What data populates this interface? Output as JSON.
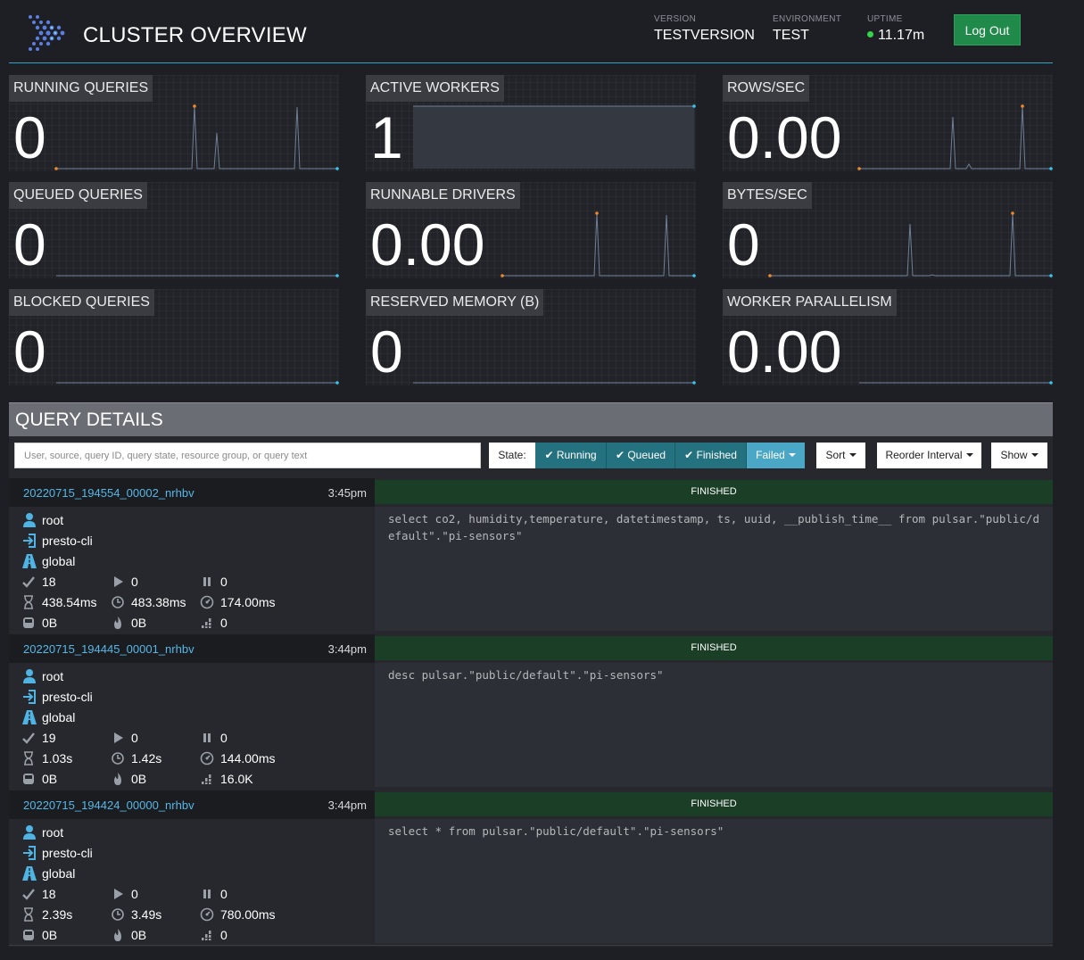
{
  "header": {
    "title": "CLUSTER OVERVIEW",
    "version_label": "VERSION",
    "version": "TESTVERSION",
    "environment_label": "ENVIRONMENT",
    "environment": "TEST",
    "uptime_label": "UPTIME",
    "uptime": "11.17m",
    "logout_label": "Log Out"
  },
  "metrics": {
    "running_queries": {
      "label": "RUNNING QUERIES",
      "value": "0"
    },
    "active_workers": {
      "label": "ACTIVE WORKERS",
      "value": "1"
    },
    "rows_sec": {
      "label": "ROWS/SEC",
      "value": "0.00"
    },
    "queued_queries": {
      "label": "QUEUED QUERIES",
      "value": "0"
    },
    "runnable_drivers": {
      "label": "RUNNABLE DRIVERS",
      "value": "0.00"
    },
    "bytes_sec": {
      "label": "BYTES/SEC",
      "value": "0"
    },
    "blocked_queries": {
      "label": "BLOCKED QUERIES",
      "value": "0"
    },
    "reserved_memory": {
      "label": "RESERVED MEMORY (B)",
      "value": "0"
    },
    "worker_parallelism": {
      "label": "WORKER PARALLELISM",
      "value": "0.00"
    }
  },
  "query_details": {
    "title": "QUERY DETAILS",
    "search_placeholder": "User, source, query ID, query state, resource group, or query text",
    "state_label": "State:",
    "filters": {
      "running": "Running",
      "queued": "Queued",
      "finished": "Finished",
      "failed": "Failed"
    },
    "sort_label": "Sort",
    "reorder_label": "Reorder Interval",
    "show_label": "Show"
  },
  "queries": [
    {
      "id": "20220715_194554_00002_nrhbv",
      "time": "3:45pm",
      "state": "FINISHED",
      "user": "root",
      "source": "presto-cli",
      "resource_group": "global",
      "completed_splits": "18",
      "running_splits": "0",
      "queued_splits": "0",
      "wall_time": "438.54ms",
      "elapsed_time": "483.38ms",
      "cpu_time": "174.00ms",
      "memory": "0B",
      "peak_memory": "0B",
      "input_rows": "0",
      "sql": "select co2, humidity,temperature, datetimestamp, ts, uuid, __publish_time__ from pulsar.\"public/default\".\"pi-sensors\""
    },
    {
      "id": "20220715_194445_00001_nrhbv",
      "time": "3:44pm",
      "state": "FINISHED",
      "user": "root",
      "source": "presto-cli",
      "resource_group": "global",
      "completed_splits": "19",
      "running_splits": "0",
      "queued_splits": "0",
      "wall_time": "1.03s",
      "elapsed_time": "1.42s",
      "cpu_time": "144.00ms",
      "memory": "0B",
      "peak_memory": "0B",
      "input_rows": "16.0K",
      "sql": "desc pulsar.\"public/default\".\"pi-sensors\""
    },
    {
      "id": "20220715_194424_00000_nrhbv",
      "time": "3:44pm",
      "state": "FINISHED",
      "user": "root",
      "source": "presto-cli",
      "resource_group": "global",
      "completed_splits": "18",
      "running_splits": "0",
      "queued_splits": "0",
      "wall_time": "2.39s",
      "elapsed_time": "3.49s",
      "cpu_time": "780.00ms",
      "memory": "0B",
      "peak_memory": "0B",
      "input_rows": "0",
      "sql": "select * from pulsar.\"public/default\".\"pi-sensors\""
    }
  ],
  "colors": {
    "accent": "#56b7e6",
    "finished": "#1b3e26",
    "logout": "#1f8a4a",
    "filter_active": "#24727f",
    "filter_failed": "#4aa7c6",
    "spark_start": "#f08a24",
    "spark_end": "#38c6e8"
  }
}
